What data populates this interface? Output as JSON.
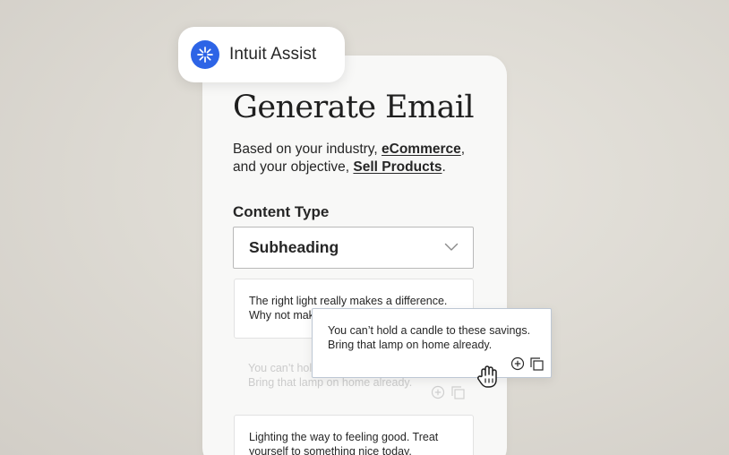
{
  "badge": {
    "label": "Intuit Assist",
    "icon": "sparkle-icon",
    "icon_color": "#2d64e6"
  },
  "title": "Generate Email",
  "description": {
    "prefix": "Based on your industry, ",
    "industry": "eCommerce",
    "middle": ",",
    "line2_prefix": "and your objective, ",
    "objective": "Sell Products",
    "suffix": "."
  },
  "content_type": {
    "label": "Content Type",
    "selected": "Subheading",
    "icon": "chevron-down-icon"
  },
  "results": [
    {
      "line1": "The right light really makes a difference.",
      "line2": "Why not make"
    },
    {
      "line1": "You can’t hold a candle to these savings.",
      "line2": "Bring that lamp on home already."
    },
    {
      "line1": "Lighting the way to feeling good. Treat",
      "line2": "yourself to something nice today."
    }
  ],
  "popup": {
    "line1": "You can’t hold a candle to these savings.",
    "line2": "Bring that lamp on home already.",
    "actions": [
      "add-circle-icon",
      "copy-icon"
    ]
  },
  "cursor": "hand-pointer-icon"
}
